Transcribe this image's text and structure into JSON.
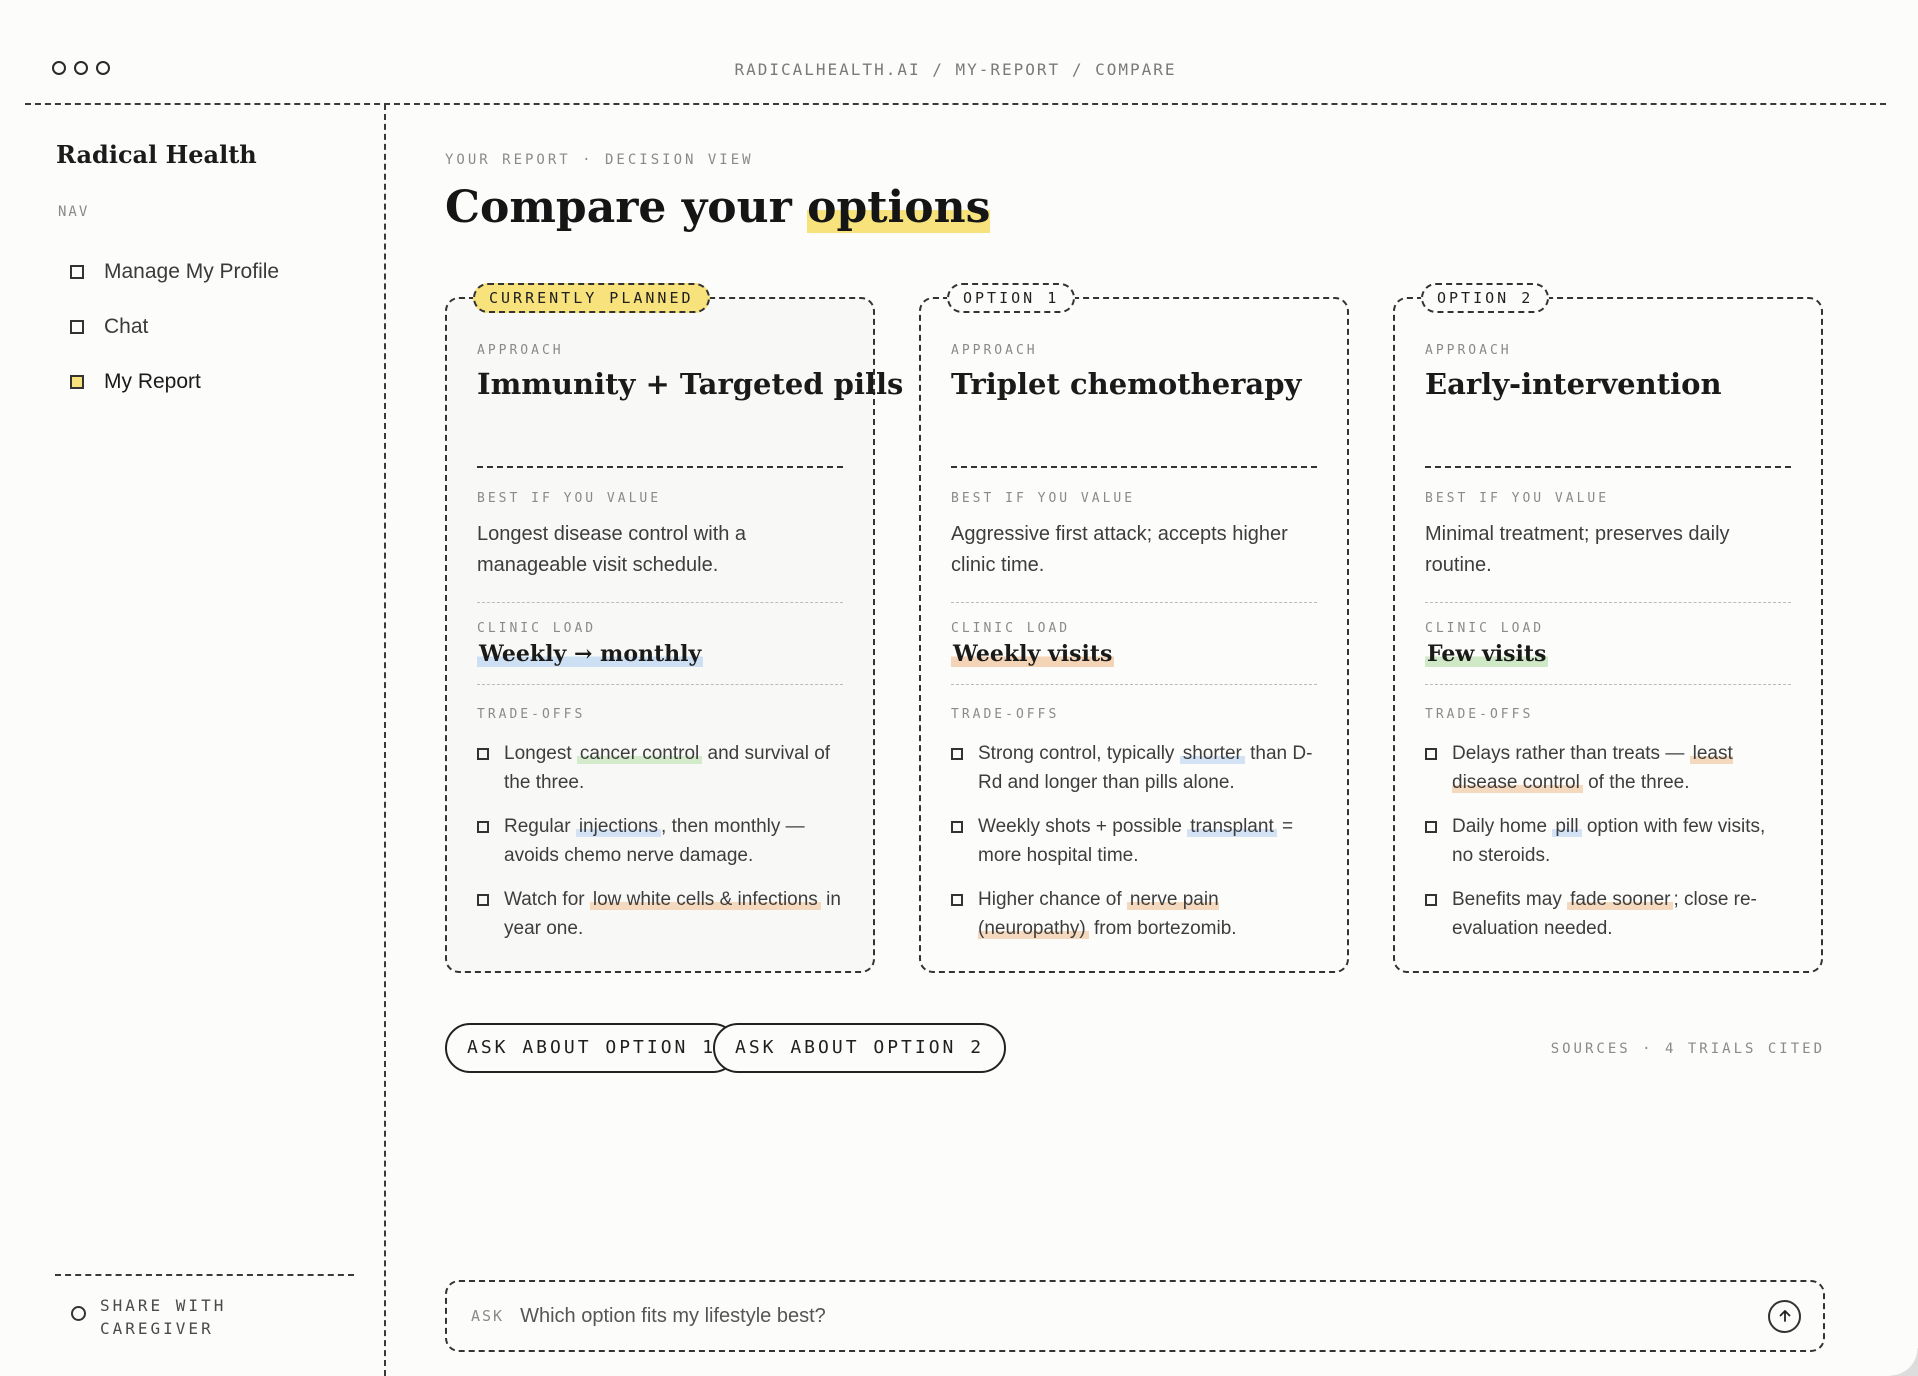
{
  "window": {
    "breadcrumb": "RADICALHEALTH.AI / MY-REPORT / COMPARE"
  },
  "sidebar": {
    "brand": "Radical Health",
    "nav_label": "NAV",
    "items": [
      {
        "label": "Manage My Profile",
        "active": false
      },
      {
        "label": "Chat",
        "active": false
      },
      {
        "label": "My Report",
        "active": true
      }
    ],
    "share_label": "SHARE WITH CAREGIVER"
  },
  "main": {
    "eyebrow": "YOUR REPORT · DECISION VIEW",
    "title_prefix": "Compare your ",
    "title_highlight": "options",
    "labels": {
      "approach": "APPROACH",
      "best": "BEST IF YOU VALUE",
      "load": "CLINIC LOAD",
      "tradeoffs": "TRADE-OFFS"
    },
    "cards": [
      {
        "tag": "CURRENTLY PLANNED",
        "approach": "Immunity + Targeted pills",
        "best": "Longest disease control with a manageable visit schedule.",
        "load": "Weekly → monthly",
        "tradeoffs": [
          {
            "before": "Longest ",
            "hl": "cancer control",
            "after": " and survival of the three."
          },
          {
            "before": "Regular ",
            "hl": "injections",
            "after": ", then monthly — avoids chemo nerve damage."
          },
          {
            "before": "Watch for ",
            "hl": "low white cells & infections",
            "after": " in year one."
          }
        ]
      },
      {
        "tag": "OPTION 1",
        "approach": "Triplet chemotherapy",
        "best": "Aggressive first attack; accepts higher clinic time.",
        "load": "Weekly visits",
        "tradeoffs": [
          {
            "before": "Strong control, typically ",
            "hl": "shorter",
            "after": " than D-Rd and longer than pills alone."
          },
          {
            "before": "Weekly shots + possible ",
            "hl": "transplant",
            "after": " = more hospital time."
          },
          {
            "before": "Higher chance of ",
            "hl": "nerve pain (neuropathy)",
            "after": " from bortezomib."
          }
        ]
      },
      {
        "tag": "OPTION 2",
        "approach": "Early-intervention",
        "best": "Minimal treatment; preserves daily routine.",
        "load": "Few visits",
        "tradeoffs": [
          {
            "before": "Delays rather than treats — ",
            "hl": "least disease control",
            "after": " of the three."
          },
          {
            "before": "Daily home ",
            "hl": "pill",
            "after": " option with few visits, no steroids."
          },
          {
            "before": "Benefits may ",
            "hl": "fade sooner",
            "after": "; close re-evaluation needed."
          }
        ]
      }
    ],
    "actions": {
      "ask1": "ASK ABOUT OPTION 1",
      "ask2": "ASK ABOUT OPTION 2"
    },
    "sources": "SOURCES · 4 TRIALS CITED",
    "ask": {
      "label": "ASK",
      "placeholder": "Which option fits my lifestyle best?"
    }
  },
  "colors": {
    "accent_yellow": "#f7e27c",
    "highlight_blue": "#d3e3f5",
    "highlight_orange": "#f5d9bf",
    "highlight_green": "#d4ebcb",
    "background": "#fcfcfb"
  },
  "icons": {
    "window_controls": "circle-icons",
    "send": "arrow-up-icon"
  }
}
